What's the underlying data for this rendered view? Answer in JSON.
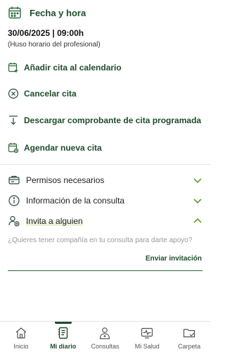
{
  "appointment": {
    "section_title": "Fecha y hora",
    "datetime": "30/06/2025 | 09:00h",
    "timezone_note": "(Huso horario del profesional)"
  },
  "actions": [
    {
      "label": "Añadir cita al calendario",
      "icon": "calendar-add-icon"
    },
    {
      "label": "Cancelar cita",
      "icon": "cancel-circle-icon"
    },
    {
      "label": "Descargar comprobante de cita programada",
      "icon": "download-icon"
    },
    {
      "label": "Agendar nueva cita",
      "icon": "calendar-new-icon"
    }
  ],
  "accordions": [
    {
      "label": "Permisos necesarios",
      "icon": "permissions-icon",
      "expanded": false
    },
    {
      "label": "Información de la consulta",
      "icon": "info-icon",
      "expanded": false
    },
    {
      "label": "Invita a alguien",
      "icon": "invite-person-icon",
      "expanded": true
    }
  ],
  "invite": {
    "question": "¿Quieres tener compañía en tu consulta para darte apoyo?",
    "button_label": "Enviar invitación"
  },
  "bottom_nav": [
    {
      "label": "Inicio",
      "icon": "home-icon",
      "active": false
    },
    {
      "label": "Mi diario",
      "icon": "diary-icon",
      "active": true
    },
    {
      "label": "Consultas",
      "icon": "doctor-icon",
      "active": false
    },
    {
      "label": "Mi Salud",
      "icon": "health-monitor-icon",
      "active": false
    },
    {
      "label": "Carpeta",
      "icon": "folder-icon",
      "active": false
    }
  ],
  "colors": {
    "primary": "#1e4d2b",
    "accent_chevron": "#5aa02c",
    "highlight": "#e8f3d8"
  }
}
